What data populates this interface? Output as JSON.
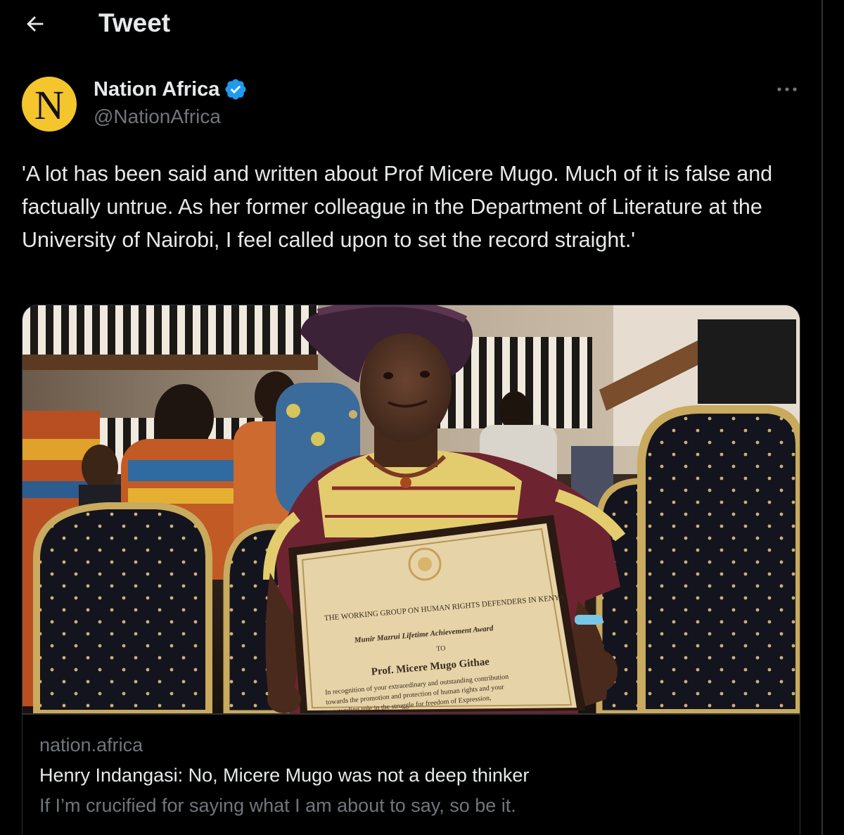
{
  "header": {
    "title": "Tweet",
    "back_icon": "arrow-left-icon"
  },
  "author": {
    "avatar_letter": "N",
    "avatar_color": "#f4c52c",
    "display_name": "Nation Africa",
    "verified_icon": "verified-badge-icon",
    "verified_color": "#1d9bf0",
    "handle": "@NationAfrica",
    "more_icon": "more-options-icon"
  },
  "tweet": {
    "text": "'A lot has been said and written about Prof Micere Mugo. Much of it is false and factually untrue. As her former colleague in the Department of Literature at the University of Nairobi, I feel called upon to set the record straight.'"
  },
  "card": {
    "certificate_lines": [
      "THE WORKING GROUP ON HUMAN RIGHTS DEFENDERS IN KENYA",
      "Munir Mazrui Lifetime Achievement Award",
      "TO",
      "Prof. Micere Mugo Githae",
      "In recognition of your extraordinary and outstanding contribution",
      "towards the promotion and protection of human rights and your",
      "outstanding role in the struggle for freedom of Expression,"
    ],
    "domain": "nation.africa",
    "title": "Henry Indangasi: No, Micere Mugo was not a deep thinker",
    "description": "If I’m crucified for saying what I am about to say, so be it."
  },
  "colors": {
    "background": "#000000",
    "text_primary": "#e7e9ea",
    "text_secondary": "#71767b",
    "border": "#2f3336"
  }
}
